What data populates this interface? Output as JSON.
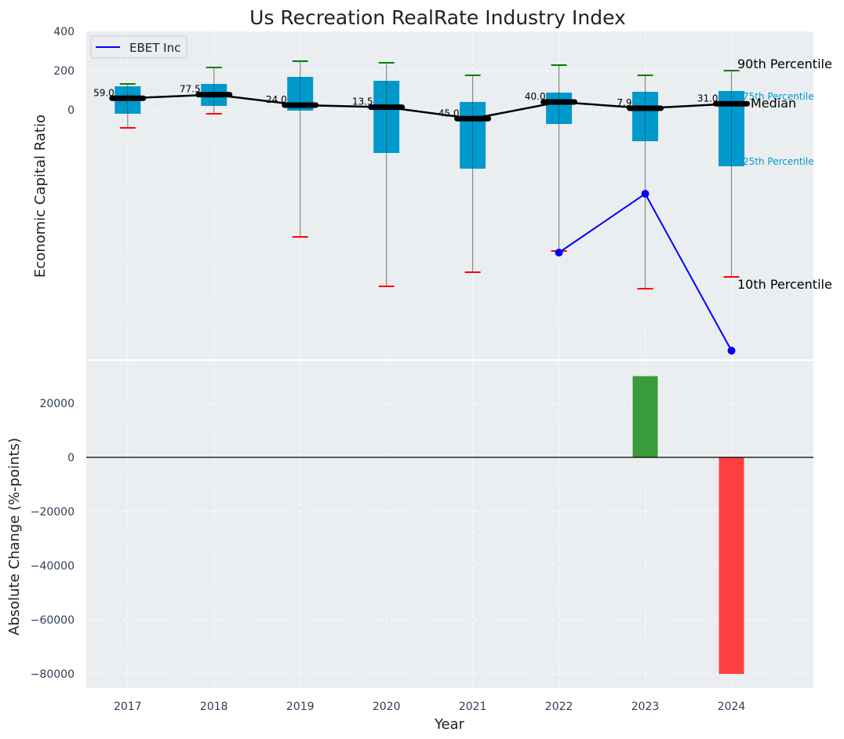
{
  "chart_data": [
    {
      "type": "box",
      "title": "Us Recreation RealRate Industry Index",
      "xlabel": "",
      "ylabel": "Economic Capital Ratio",
      "x": [
        2017,
        2018,
        2019,
        2020,
        2021,
        2022,
        2023,
        2024
      ],
      "xlim": [
        2016.52,
        2024.95
      ],
      "ylim": [
        -1272,
        400
      ],
      "yticks": [
        0,
        200,
        400
      ],
      "grid": true,
      "legend_position": "top-left",
      "percentiles": {
        "p90": [
          132,
          216,
          248,
          240,
          176,
          228,
          176,
          200
        ],
        "p75": [
          120,
          132,
          168,
          148,
          40,
          88,
          92,
          96
        ],
        "median": [
          59.0,
          77.5,
          24.0,
          13.5,
          -45.0,
          40.0,
          7.9,
          31.0
        ],
        "p25": [
          -20,
          20,
          -4,
          -220,
          -300,
          -72,
          -160,
          -288
        ],
        "p10": [
          -92,
          -20,
          -648,
          -900,
          -828,
          -720,
          -912,
          -852
        ]
      },
      "median_labels": [
        "59.0",
        "77.5",
        "24.0",
        "13.5",
        "-45.0",
        "40.0",
        "7.9",
        "31.0"
      ],
      "series": [
        {
          "name": "EBET Inc",
          "x": [
            2022,
            2023,
            2024
          ],
          "values": [
            -728,
            -428,
            -1228
          ],
          "color": "#0000ff"
        }
      ],
      "annotations": {
        "p90": "90th Percentile",
        "p75": "75th Percentile",
        "median": "Median",
        "p25": "25th Percentile",
        "p10": "10th Percentile"
      },
      "colors": {
        "box": "#0099cc",
        "p90": "#008000",
        "p10": "#ff0000",
        "median": "#000000",
        "background": "#eaeef0"
      }
    },
    {
      "type": "bar",
      "xlabel": "Year",
      "ylabel": "Absolute Change (%-points)",
      "categories": [
        2017,
        2018,
        2019,
        2020,
        2021,
        2022,
        2023,
        2024
      ],
      "values": [
        null,
        null,
        null,
        null,
        null,
        null,
        30000,
        -80000
      ],
      "ylim": [
        -85200,
        35650
      ],
      "yticks": [
        -80000,
        -60000,
        -40000,
        -20000,
        0,
        20000
      ],
      "grid": true,
      "colors": {
        "positive": "#3a9b3a",
        "negative": "#ff4040"
      }
    }
  ]
}
